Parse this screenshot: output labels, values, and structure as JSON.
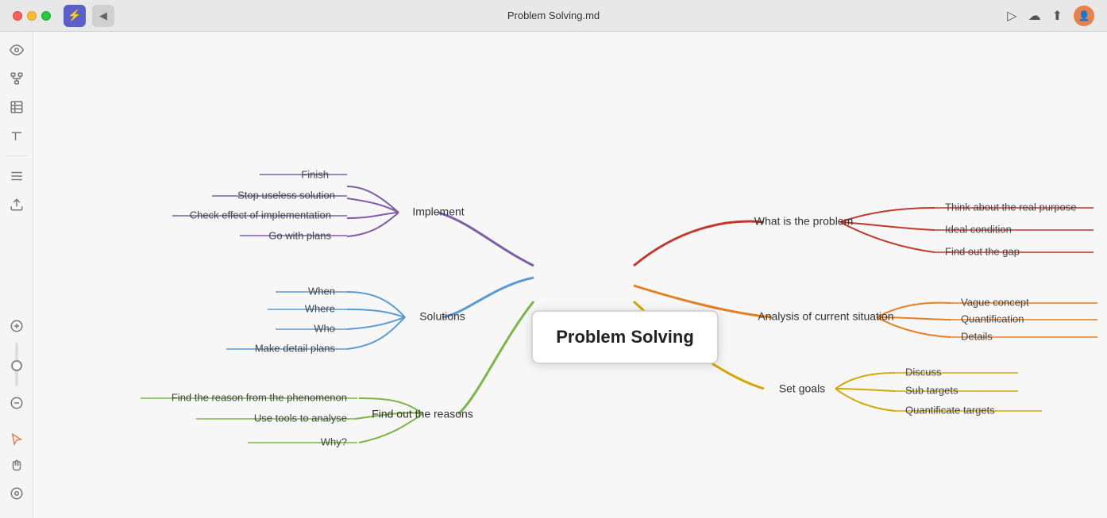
{
  "titlebar": {
    "title": "Problem Solving.md",
    "back_label": "◀"
  },
  "sidebar": {
    "icons": [
      {
        "name": "eye-icon",
        "symbol": "👁",
        "active": false
      },
      {
        "name": "hierarchy-icon",
        "symbol": "⊞",
        "active": false
      },
      {
        "name": "table-icon",
        "symbol": "▤",
        "active": false
      },
      {
        "name": "text-icon",
        "symbol": "T",
        "active": false
      },
      {
        "name": "list-icon",
        "symbol": "≡",
        "active": false
      },
      {
        "name": "export-icon",
        "symbol": "⬆",
        "active": false
      }
    ],
    "bottom_icons": [
      {
        "name": "add-icon",
        "symbol": "+",
        "active": false
      },
      {
        "name": "minus-icon",
        "symbol": "−",
        "active": false
      },
      {
        "name": "reset-icon",
        "symbol": "⊙",
        "active": false
      },
      {
        "name": "cursor-icon",
        "symbol": "↖",
        "active": true
      },
      {
        "name": "hand-icon",
        "symbol": "✋",
        "active": false
      },
      {
        "name": "preview-icon",
        "symbol": "◎",
        "active": false
      }
    ]
  },
  "mindmap": {
    "central_node": "Problem Solving",
    "branches": {
      "implement": {
        "label": "Implement",
        "color": "#7B5EA7",
        "children": [
          "Finish",
          "Stop useless solution",
          "Check effect of implementation",
          "Go with plans"
        ]
      },
      "solutions": {
        "label": "Solutions",
        "color": "#5B9BD5",
        "children": [
          "When",
          "Where",
          "Who",
          "Make detail plans"
        ]
      },
      "find_out_reasons": {
        "label": "Find out the reasons",
        "color": "#7AB648",
        "children": [
          "Find the reason from the phenomenon",
          "Use tools to analyse",
          "Why?"
        ]
      },
      "what_is_problem": {
        "label": "What is the problem",
        "color": "#C0392B",
        "children": [
          "Think about the real purpose",
          "Ideal condition",
          "Find out the gap"
        ]
      },
      "analysis": {
        "label": "Analysis of current situation",
        "color": "#E67E22",
        "children": [
          "Vague concept",
          "Quantification",
          "Details"
        ]
      },
      "set_goals": {
        "label": "Set goals",
        "color": "#F0C040",
        "children": [
          "Discuss",
          "Sub targets",
          "Quantificate targets"
        ]
      }
    }
  }
}
